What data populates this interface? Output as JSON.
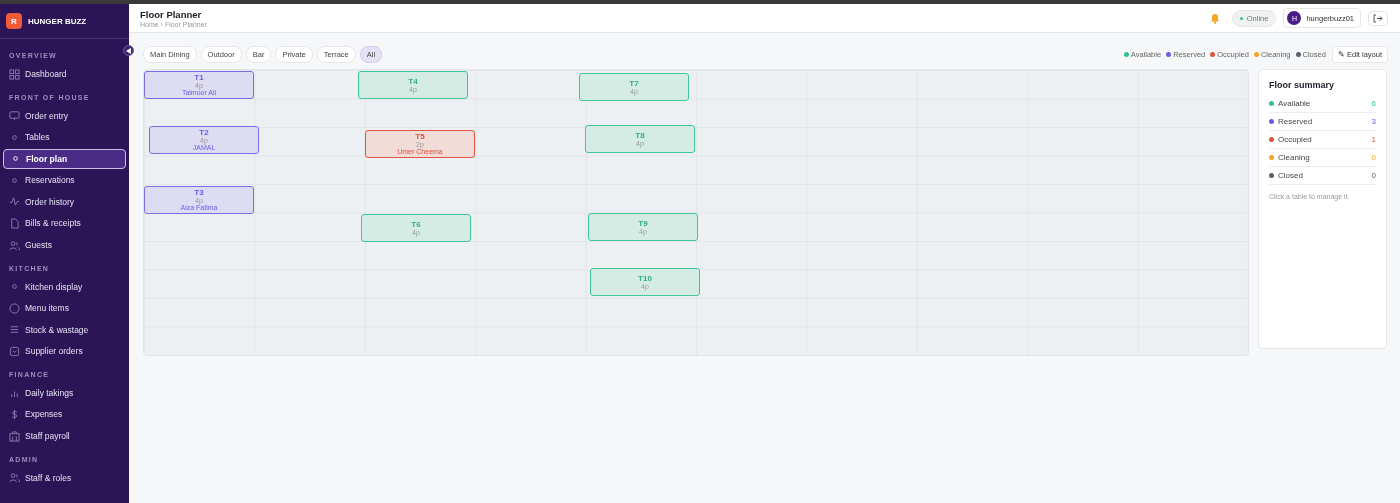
{
  "brand": {
    "initial": "R",
    "name": "HUNGER BUZZ"
  },
  "sidebar": {
    "sections": [
      {
        "title": "OVERVIEW",
        "items": [
          {
            "label": "Dashboard",
            "selected": false
          }
        ]
      },
      {
        "title": "FRONT OF HOUSE",
        "items": [
          {
            "label": "Order entry",
            "selected": false
          },
          {
            "label": "Tables",
            "selected": false
          },
          {
            "label": "Floor plan",
            "selected": true
          },
          {
            "label": "Reservations",
            "selected": false
          },
          {
            "label": "Order history",
            "selected": false
          },
          {
            "label": "Bills & receipts",
            "selected": false
          },
          {
            "label": "Guests",
            "selected": false
          }
        ]
      },
      {
        "title": "KITCHEN",
        "items": [
          {
            "label": "Kitchen display",
            "selected": false
          },
          {
            "label": "Menu items",
            "selected": false
          },
          {
            "label": "Stock & wastage",
            "selected": false
          },
          {
            "label": "Supplier orders",
            "selected": false
          }
        ]
      },
      {
        "title": "FINANCE",
        "items": [
          {
            "label": "Daily takings",
            "selected": false
          },
          {
            "label": "Expenses",
            "selected": false
          },
          {
            "label": "Staff payroll",
            "selected": false
          }
        ]
      },
      {
        "title": "ADMIN",
        "items": [
          {
            "label": "Staff & roles",
            "selected": false
          }
        ]
      }
    ]
  },
  "header": {
    "title": "Floor Planner",
    "breadcrumb": "Home › Floor Planner",
    "status": "Online",
    "user": {
      "initial": "H",
      "name": "hungerbuzz01"
    }
  },
  "areas": [
    {
      "label": "Main Dining",
      "selected": false
    },
    {
      "label": "Outdoor",
      "selected": false
    },
    {
      "label": "Bar",
      "selected": false
    },
    {
      "label": "Private",
      "selected": false
    },
    {
      "label": "Terrace",
      "selected": false
    },
    {
      "label": "All",
      "selected": true
    }
  ],
  "legend": [
    {
      "label": "Available",
      "color": "#34c38f"
    },
    {
      "label": "Reserved",
      "color": "#6c5ce7"
    },
    {
      "label": "Occupied",
      "color": "#e0533d"
    },
    {
      "label": "Cleaning",
      "color": "#f5a524"
    },
    {
      "label": "Closed",
      "color": "#5b5f6b"
    }
  ],
  "edit_button": "✎ Edit layout",
  "tables": [
    {
      "name": "T1",
      "seats": "4p",
      "kind": "reserved",
      "guest": "Taimoor Ali"
    },
    {
      "name": "T4",
      "seats": "4p",
      "kind": "available"
    },
    {
      "name": "T7",
      "seats": "4p",
      "kind": "available"
    },
    {
      "name": "T2",
      "seats": "4p",
      "kind": "reserved",
      "guest": "JAMAL"
    },
    {
      "name": "T5",
      "seats": "2p",
      "kind": "occupied",
      "guest": "Umer Cheema"
    },
    {
      "name": "T8",
      "seats": "4p",
      "kind": "available"
    },
    {
      "name": "T3",
      "seats": "4p",
      "kind": "reserved",
      "guest": "Aiza Fatima"
    },
    {
      "name": "T6",
      "seats": "4p",
      "kind": "available"
    },
    {
      "name": "T9",
      "seats": "4p",
      "kind": "available"
    },
    {
      "name": "T10",
      "seats": "4p",
      "kind": "available"
    }
  ],
  "summary": {
    "title": "Floor summary",
    "rows": [
      {
        "label": "Available",
        "count": "6",
        "color": "#34c38f"
      },
      {
        "label": "Reserved",
        "count": "3",
        "color": "#6c5ce7"
      },
      {
        "label": "Occupied",
        "count": "1",
        "color": "#e0533d"
      },
      {
        "label": "Cleaning",
        "count": "0",
        "color": "#f5a524"
      },
      {
        "label": "Closed",
        "count": "0",
        "color": "#5b5f6b"
      }
    ],
    "hint": "Click a table to manage it."
  }
}
